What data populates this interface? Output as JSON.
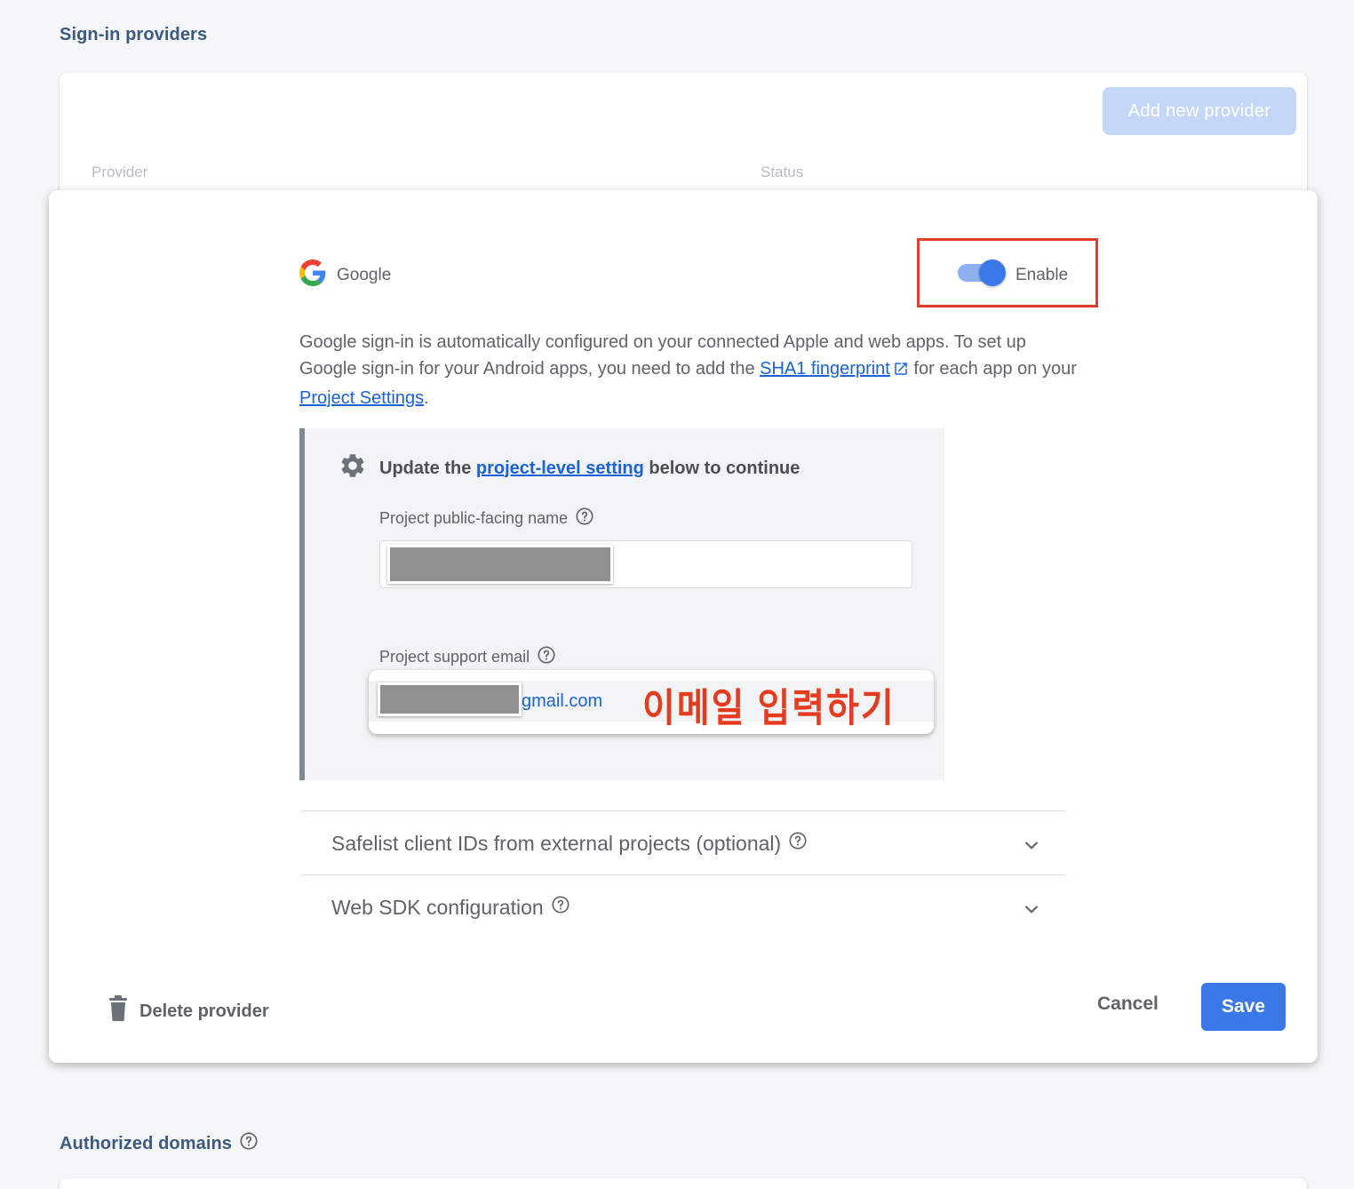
{
  "sections": {
    "sign_in_providers": "Sign-in providers",
    "authorized_domains": "Authorized domains"
  },
  "providers_table": {
    "add_button": "Add new provider",
    "col_provider": "Provider",
    "col_status": "Status"
  },
  "dialog": {
    "provider_name": "Google",
    "provider_icon": "google-g-icon",
    "toggle": {
      "label": "Enable",
      "state": "on"
    },
    "description": {
      "part1": "Google sign-in is automatically configured on your connected Apple and web apps. To set up Google sign-in for your Android apps, you need to add the ",
      "link1": "SHA1 fingerprint",
      "part2": " for each app on your ",
      "link2": "Project Settings",
      "part3": "."
    },
    "settings_panel": {
      "heading_pre": "Update the ",
      "heading_link": "project-level setting",
      "heading_post": " below to continue",
      "name_label": "Project public-facing name",
      "email_label": "Project support email",
      "email_domain": "gmail.com",
      "annotation": "이메일 입력하기"
    },
    "expanders": [
      {
        "title": "Safelist client IDs from external projects (optional)"
      },
      {
        "title": "Web SDK configuration"
      }
    ],
    "footer": {
      "delete_label": "Delete provider",
      "cancel_label": "Cancel",
      "save_label": "Save"
    }
  },
  "colors": {
    "primary": "#3b78e7",
    "link": "#1a62d6",
    "highlight_box": "#e0402b",
    "annotation": "#e53b1f"
  }
}
